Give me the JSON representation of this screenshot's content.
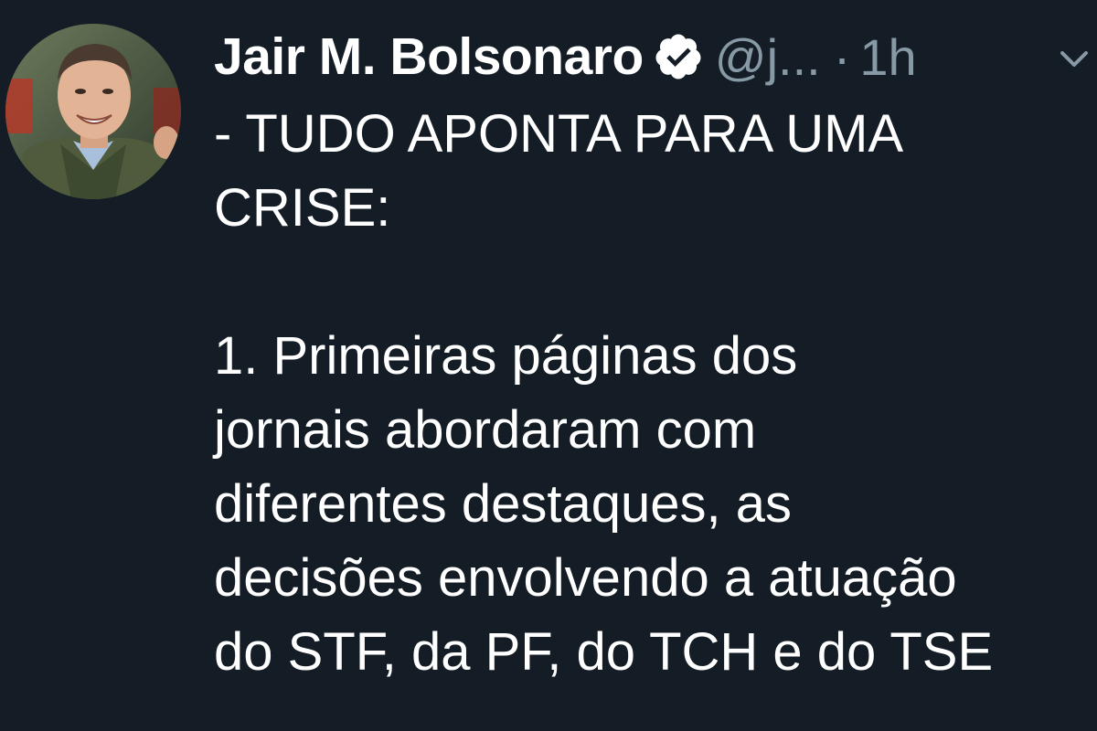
{
  "tweet": {
    "author": {
      "name": "Jair M. Bolsonaro",
      "handle": "@j...",
      "verified": true,
      "avatar_icon": "profile-photo"
    },
    "separator": "·",
    "timestamp": "1h",
    "menu_icon": "chevron-down-icon",
    "text_lines": [
      "- TUDO APONTA PARA UMA",
      "CRISE:",
      "",
      "1. Primeiras páginas dos",
      "jornais abordaram com",
      "diferentes destaques, as",
      "decisões envolvendo a atuação",
      "do STF, da PF, do TCH e do TSE"
    ]
  },
  "colors": {
    "background": "#141d26",
    "text": "#ffffff",
    "secondary_text": "#8899a6"
  }
}
